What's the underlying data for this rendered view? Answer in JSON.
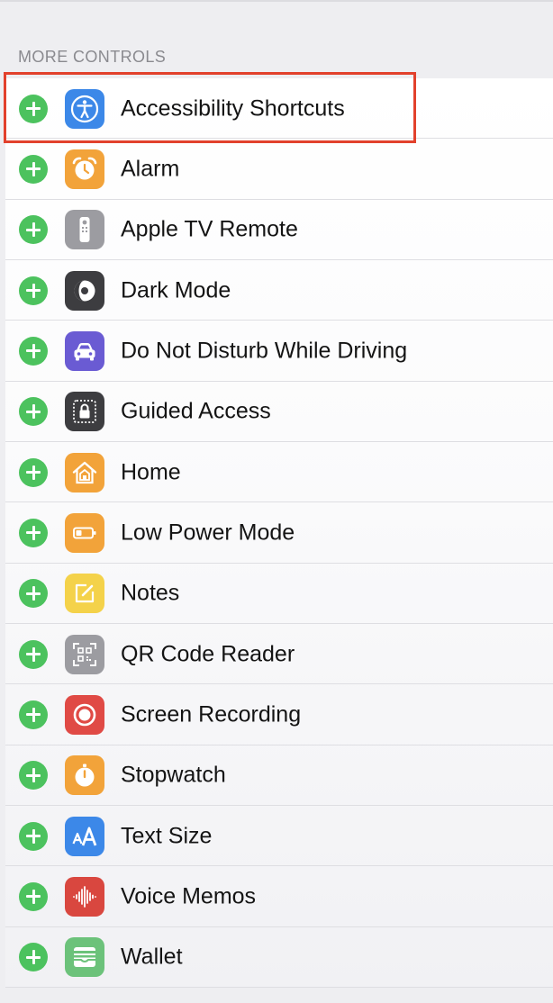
{
  "section": {
    "header": "MORE CONTROLS"
  },
  "controls": [
    {
      "label": "Accessibility Shortcuts",
      "icon": "accessibility-icon",
      "color": "#3c88e8"
    },
    {
      "label": "Alarm",
      "icon": "alarm-clock-icon",
      "color": "#f2a33a"
    },
    {
      "label": "Apple TV Remote",
      "icon": "tv-remote-icon",
      "color": "#9c9ca1"
    },
    {
      "label": "Dark Mode",
      "icon": "dark-mode-icon",
      "color": "#3d3d40"
    },
    {
      "label": "Do Not Disturb While Driving",
      "icon": "car-icon",
      "color": "#6a5bd3"
    },
    {
      "label": "Guided Access",
      "icon": "lock-icon",
      "color": "#3d3d40"
    },
    {
      "label": "Home",
      "icon": "home-icon",
      "color": "#f2a33a"
    },
    {
      "label": "Low Power Mode",
      "icon": "battery-icon",
      "color": "#f2a33a"
    },
    {
      "label": "Notes",
      "icon": "notes-icon",
      "color": "#f4d24a"
    },
    {
      "label": "QR Code Reader",
      "icon": "qr-code-icon",
      "color": "#9c9ca1"
    },
    {
      "label": "Screen Recording",
      "icon": "record-icon",
      "color": "#e04a45"
    },
    {
      "label": "Stopwatch",
      "icon": "stopwatch-icon",
      "color": "#f2a33a"
    },
    {
      "label": "Text Size",
      "icon": "text-size-icon",
      "color": "#3c88e8"
    },
    {
      "label": "Voice Memos",
      "icon": "waveform-icon",
      "color": "#d9473f"
    },
    {
      "label": "Wallet",
      "icon": "wallet-icon",
      "color": "#6cc27a"
    }
  ],
  "colors": {
    "add_button": "#4cc25e",
    "highlight_box": "#e2412c"
  }
}
